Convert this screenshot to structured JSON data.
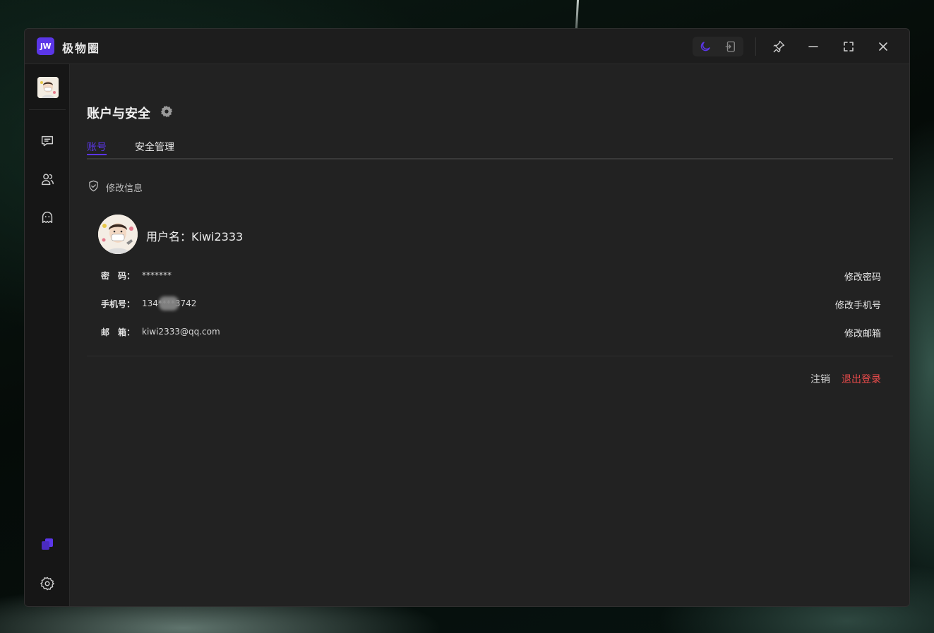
{
  "app": {
    "logo_text": "JW",
    "title": "极物圈"
  },
  "titlebar": {
    "theme_dark_icon": "moon-icon",
    "theme_light_icon": "exit-frame-icon",
    "pin_icon": "pin-icon",
    "minimize_icon": "minimize-icon",
    "maximize_icon": "fullscreen-icon",
    "close_icon": "close-icon"
  },
  "sidebar": {
    "items": [
      {
        "name": "chat",
        "icon": "chat-bubble-icon"
      },
      {
        "name": "contacts",
        "icon": "contacts-icon"
      },
      {
        "name": "ghost",
        "icon": "ghost-icon"
      }
    ],
    "bottom": [
      {
        "name": "layers",
        "icon": "layers-icon"
      },
      {
        "name": "settings",
        "icon": "gear-icon"
      }
    ]
  },
  "page": {
    "title": "账户与安全",
    "tabs": [
      {
        "label": "账号",
        "active": true
      },
      {
        "label": "安全管理",
        "active": false
      }
    ],
    "section_label": "修改信息",
    "username_label": "用户名：",
    "username": "Kiwi2333",
    "rows": [
      {
        "label": "密　码：",
        "value": "*******",
        "action": "修改密码"
      },
      {
        "label": "手机号：",
        "value": "134****3742",
        "action": "修改手机号"
      },
      {
        "label": "邮　箱：",
        "value": "kiwi2333@qq.com",
        "action": "修改邮箱"
      }
    ],
    "deregister": "注销",
    "logout": "退出登录"
  },
  "colors": {
    "accent": "#5b36e8",
    "danger": "#e94b4b",
    "window_bg": "#222222",
    "sidebar_bg": "#161616"
  }
}
